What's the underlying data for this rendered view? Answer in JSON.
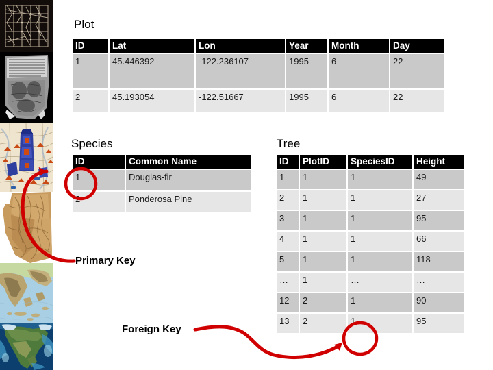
{
  "slide": {
    "background": "#ffffff",
    "accent_red": "#d00000",
    "header_bg": "#000000",
    "header_fg": "#ffffff",
    "row_dark": "#c9c9c9",
    "row_light": "#e6e6e6"
  },
  "sidebar": {
    "images": [
      {
        "name": "stick-chart-image",
        "caption": "Marshall Islands navigation stick chart"
      },
      {
        "name": "clay-tablet-image",
        "caption": "Ancient Babylonian clay map tablet"
      },
      {
        "name": "ancient-city-map-image",
        "caption": "Historic illustrated city map"
      },
      {
        "name": "topographic-relief-map-image",
        "caption": "Topographic relief map of California"
      },
      {
        "name": "greece-satellite-map-image",
        "caption": "Satellite map of Greece and the Aegean"
      },
      {
        "name": "north-america-satellite-image",
        "caption": "Satellite view of North America"
      }
    ]
  },
  "plot_table": {
    "title": "Plot",
    "columns": [
      "ID",
      "Lat",
      "Lon",
      "Year",
      "Month",
      "Day"
    ],
    "rows": [
      [
        "1",
        "45.446392",
        "-122.236107",
        "1995",
        "6",
        "22"
      ],
      [
        "2",
        "45.193054",
        "-122.51667",
        "1995",
        "6",
        "22"
      ]
    ]
  },
  "species_table": {
    "title": "Species",
    "columns": [
      "ID",
      "Common Name"
    ],
    "rows": [
      [
        "1",
        "Douglas-fir"
      ],
      [
        "2",
        "Ponderosa Pine"
      ]
    ]
  },
  "tree_table": {
    "title": "Tree",
    "columns": [
      "ID",
      "PlotID",
      "SpeciesID",
      "Height"
    ],
    "rows": [
      [
        "1",
        "1",
        "1",
        "49"
      ],
      [
        "2",
        "1",
        "1",
        "27"
      ],
      [
        "3",
        "1",
        "1",
        "95"
      ],
      [
        "4",
        "1",
        "1",
        "66"
      ],
      [
        "5",
        "1",
        "1",
        "118"
      ],
      [
        "…",
        "1",
        "…",
        "…"
      ],
      [
        "12",
        "2",
        "1",
        "90"
      ],
      [
        "13",
        "2",
        "1",
        "95"
      ]
    ]
  },
  "annotations": {
    "primary_key_label": "Primary Key",
    "foreign_key_label": "Foreign Key",
    "primary_key_target": "Species.ID value 1",
    "foreign_key_target": "Tree.SpeciesID value 1 (row 13)"
  }
}
